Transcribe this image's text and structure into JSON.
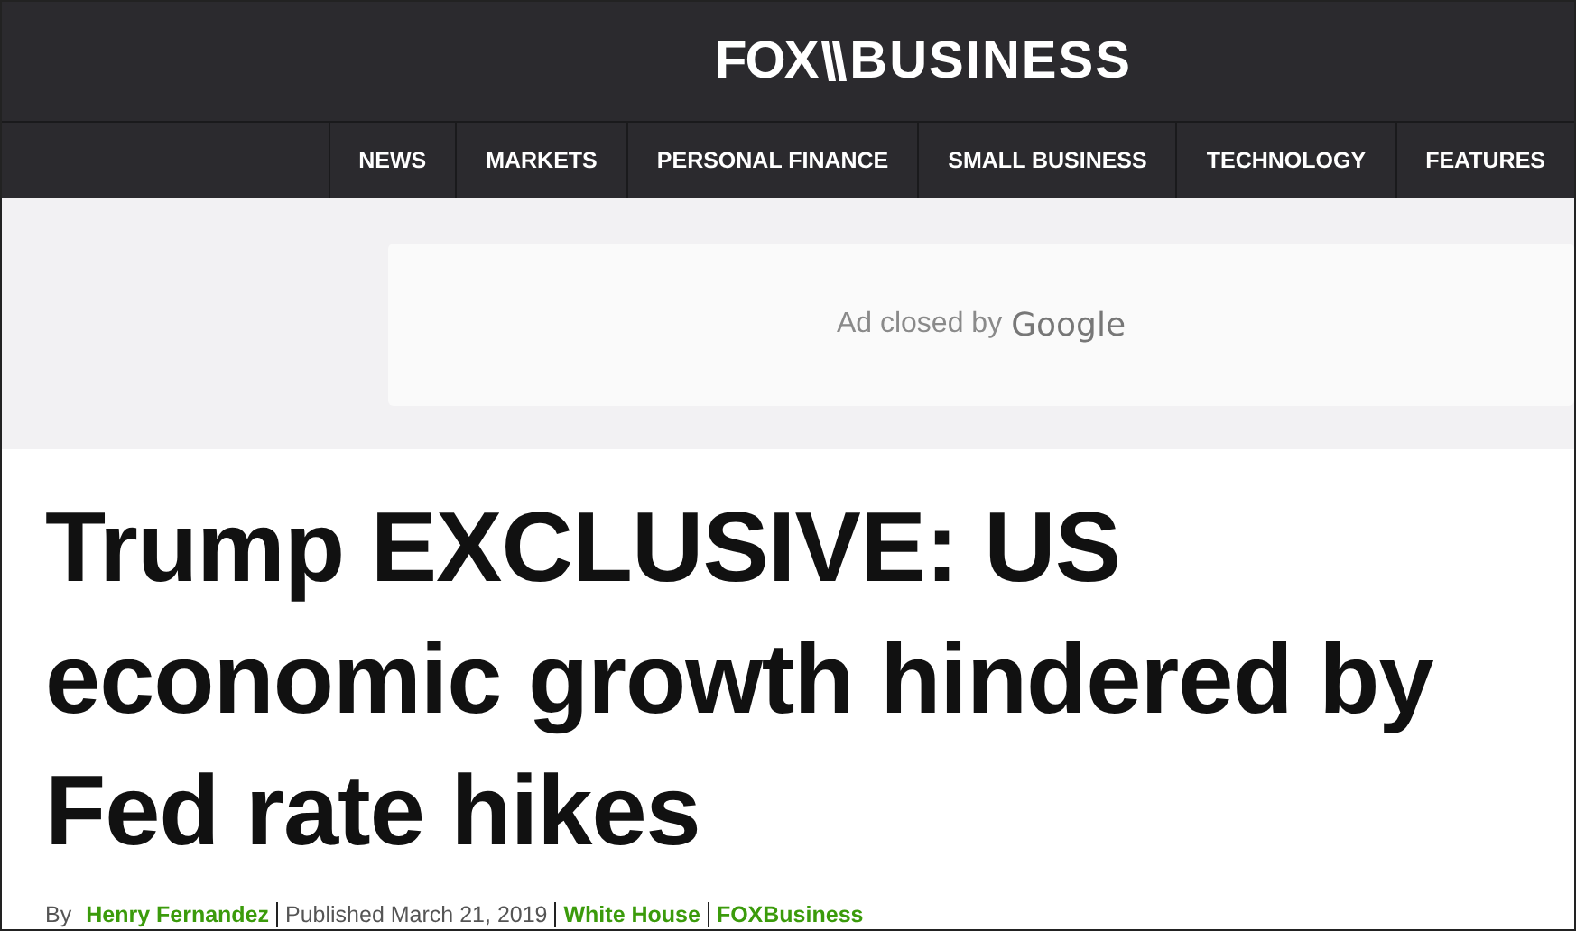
{
  "header": {
    "logo": {
      "brand": "FOX",
      "section": "BUSINESS"
    }
  },
  "nav": {
    "items": [
      {
        "label": "NEWS"
      },
      {
        "label": "MARKETS"
      },
      {
        "label": "PERSONAL FINANCE"
      },
      {
        "label": "SMALL BUSINESS"
      },
      {
        "label": "TECHNOLOGY"
      },
      {
        "label": "FEATURES"
      }
    ]
  },
  "ad": {
    "text": "Ad closed by",
    "brand": "Google"
  },
  "article": {
    "headline": "Trump EXCLUSIVE: US economic growth hindered by Fed rate hikes",
    "byline": {
      "by": "By",
      "author": "Henry Fernandez",
      "published": "Published March 21, 2019",
      "tags": [
        "White House",
        "FOXBusiness"
      ]
    }
  }
}
